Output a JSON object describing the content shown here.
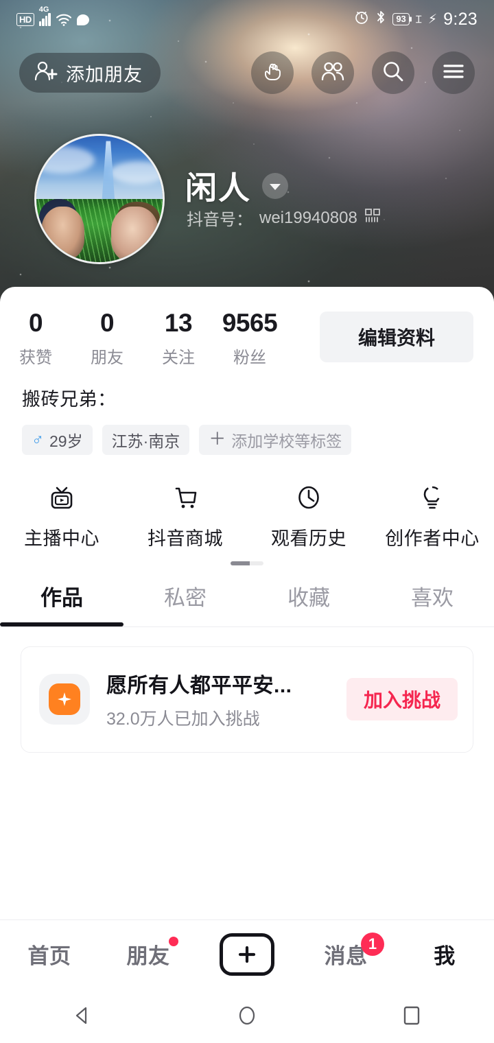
{
  "status_bar": {
    "hd_label": "HD",
    "network_label": "4G",
    "wifi_icon": "wifi-icon",
    "chat_icon": "chat-bubble-icon",
    "alarm_icon": "alarm-clock-icon",
    "bluetooth_icon": "bluetooth-icon",
    "battery_level": "93",
    "vibrate_icon": "vibrate-icon",
    "charging_icon": "charging-bolt-icon",
    "time": "9:23"
  },
  "topbar": {
    "add_friend_label": "添加朋友",
    "add_friend_icon": "add-person-icon",
    "actions": [
      {
        "icon": "pointing-hand-icon",
        "name": "pointing-hand-button"
      },
      {
        "icon": "two-people-icon",
        "name": "friends-button"
      },
      {
        "icon": "search-icon",
        "name": "search-button"
      },
      {
        "icon": "hamburger-menu-icon",
        "name": "menu-button"
      }
    ]
  },
  "profile": {
    "name": "闲人",
    "caret_icon": "chevron-down-icon",
    "douyin_id_label": "抖音号：",
    "douyin_id": "wei19940808",
    "qr_icon": "qr-code-icon",
    "avatar_alt": "anime-artwork-avatar"
  },
  "stats": [
    {
      "value": "0",
      "label": "获赞",
      "name": "stat-likes"
    },
    {
      "value": "0",
      "label": "朋友",
      "name": "stat-friends"
    },
    {
      "value": "13",
      "label": "关注",
      "name": "stat-following"
    },
    {
      "value": "9565",
      "label": "粉丝",
      "name": "stat-fans"
    }
  ],
  "edit_profile_label": "编辑资料",
  "bio": "搬砖兄弟：",
  "tags": [
    {
      "icon": "male-gender-icon",
      "label": "29岁",
      "muted": false,
      "name": "tag-age"
    },
    {
      "icon": "",
      "label": "江苏·南京",
      "muted": false,
      "name": "tag-location"
    },
    {
      "icon": "plus-icon",
      "label": "添加学校等标签",
      "muted": true,
      "name": "tag-add-school"
    }
  ],
  "quick_actions": [
    {
      "icon": "tv-play-icon",
      "label": "主播中心",
      "name": "quick-anchor-center"
    },
    {
      "icon": "shopping-cart-icon",
      "label": "抖音商城",
      "name": "quick-douyin-mall"
    },
    {
      "icon": "clock-icon",
      "label": "观看历史",
      "name": "quick-watch-history"
    },
    {
      "icon": "lightbulb-icon",
      "label": "创作者中心",
      "name": "quick-creator-center"
    }
  ],
  "tabs": [
    {
      "label": "作品",
      "active": true,
      "name": "tab-works"
    },
    {
      "label": "私密",
      "active": false,
      "name": "tab-private"
    },
    {
      "label": "收藏",
      "active": false,
      "name": "tab-favorites"
    },
    {
      "label": "喜欢",
      "active": false,
      "name": "tab-likes"
    }
  ],
  "challenge": {
    "icon": "sparkle-badge-icon",
    "title": "愿所有人都平平安...",
    "subtitle": "32.0万人已加入挑战",
    "button_label": "加入挑战",
    "button_color": "#f5264f",
    "button_bg": "#feecef",
    "icon_color": "#ff8120"
  },
  "bottom_nav": [
    {
      "label": "首页",
      "active": false,
      "badge": "",
      "dot": false,
      "name": "nav-home"
    },
    {
      "label": "朋友",
      "active": false,
      "badge": "",
      "dot": true,
      "name": "nav-friends"
    },
    {
      "label": "",
      "active": false,
      "badge": "",
      "dot": false,
      "name": "nav-create",
      "icon": "plus-icon"
    },
    {
      "label": "消息",
      "active": false,
      "badge": "1",
      "dot": false,
      "name": "nav-messages"
    },
    {
      "label": "我",
      "active": true,
      "badge": "",
      "dot": false,
      "name": "nav-me"
    }
  ],
  "android_nav": {
    "back_icon": "triangle-back-icon",
    "home_icon": "circle-home-icon",
    "recents_icon": "square-recents-icon"
  },
  "colors": {
    "accent_red": "#fe2c55",
    "text_primary": "#14141a",
    "text_secondary": "#8b8b94",
    "chip_bg": "#f2f3f5"
  }
}
